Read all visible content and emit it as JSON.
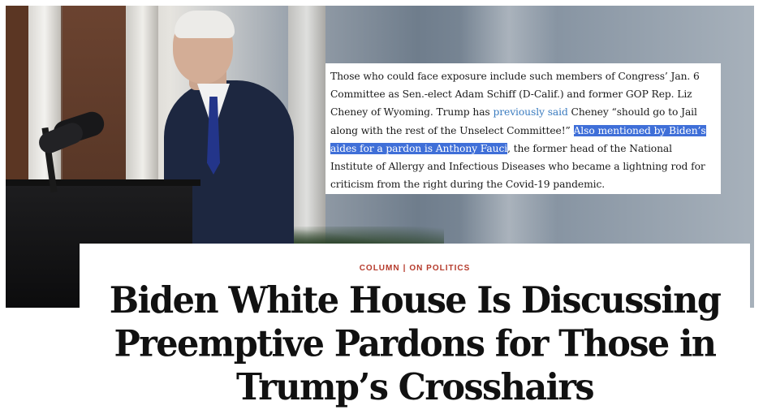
{
  "quote": {
    "part1": "Those who could face exposure include such members of Congress’ Jan. 6 Committee as Sen.-elect Adam Schiff (D-Calif.) and former GOP Rep. Liz Cheney of Wyoming. Trump has ",
    "link_text": "previously said",
    "part2": " Cheney “should go to Jail along with the rest of the Unselect Committee!” ",
    "highlight": "Also mentioned by Biden’s aides for a pardon is Anthony Fauci",
    "part3": ", the former head of the National Institute of Allergy and Infectious Diseases who became a lightning rod for criticism from the right during the Covid-19 pandemic."
  },
  "article": {
    "kicker_1": "COLUMN",
    "kicker_sep": "|",
    "kicker_2": "ON POLITICS",
    "headline_lines": [
      "Biden White House Is Discussing",
      "Preemptive Pardons for Those in",
      "Trump’s Crosshairs"
    ]
  },
  "colors": {
    "kicker": "#b53a2b",
    "link": "#3a7bbf",
    "highlight": "#3f6fd8"
  }
}
